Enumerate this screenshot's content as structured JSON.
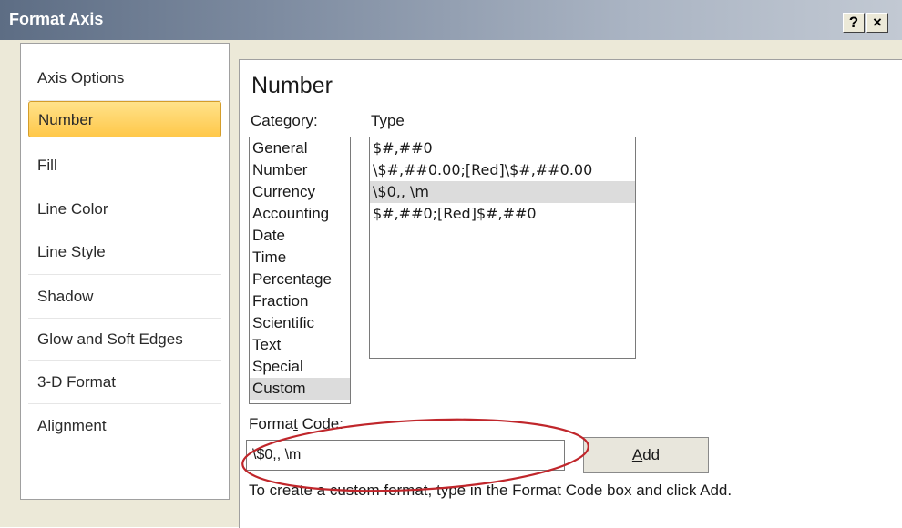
{
  "window": {
    "title": "Format Axis",
    "help_label": "?",
    "close_label": "×"
  },
  "nav": {
    "items": [
      {
        "label": "Axis Options",
        "selected": false
      },
      {
        "label": "Number",
        "selected": true
      },
      {
        "label": "Fill",
        "selected": false
      },
      {
        "label": "Line Color",
        "selected": false
      },
      {
        "label": "Line Style",
        "selected": false
      },
      {
        "label": "Shadow",
        "selected": false
      },
      {
        "label": "Glow and Soft Edges",
        "selected": false
      },
      {
        "label": "3-D Format",
        "selected": false
      },
      {
        "label": "Alignment",
        "selected": false
      }
    ]
  },
  "panel": {
    "title": "Number",
    "category_label_prefix": "C",
    "category_label_rest": "ategory:",
    "type_label": "Type",
    "categories": [
      "General",
      "Number",
      "Currency",
      "Accounting",
      "Date",
      "Time",
      "Percentage",
      "Fraction",
      "Scientific",
      "Text",
      "Special",
      "Custom"
    ],
    "selected_category": "Custom",
    "types": [
      "$#,##0",
      "\\$#,##0.00;[Red]\\$#,##0.00",
      "\\$0,, \\m",
      "$#,##0;[Red]$#,##0"
    ],
    "selected_type": "\\$0,, \\m",
    "format_code_label_a": "Forma",
    "format_code_label_u": "t",
    "format_code_label_b": " Code:",
    "format_code_value": "\\$0,, \\m",
    "add_label_u": "A",
    "add_label_rest": "dd",
    "hint": "To create a custom format, type in the Format Code box and click Add."
  },
  "colors": {
    "selection_accent": "#ffc84a",
    "annotation": "#c0262b"
  }
}
